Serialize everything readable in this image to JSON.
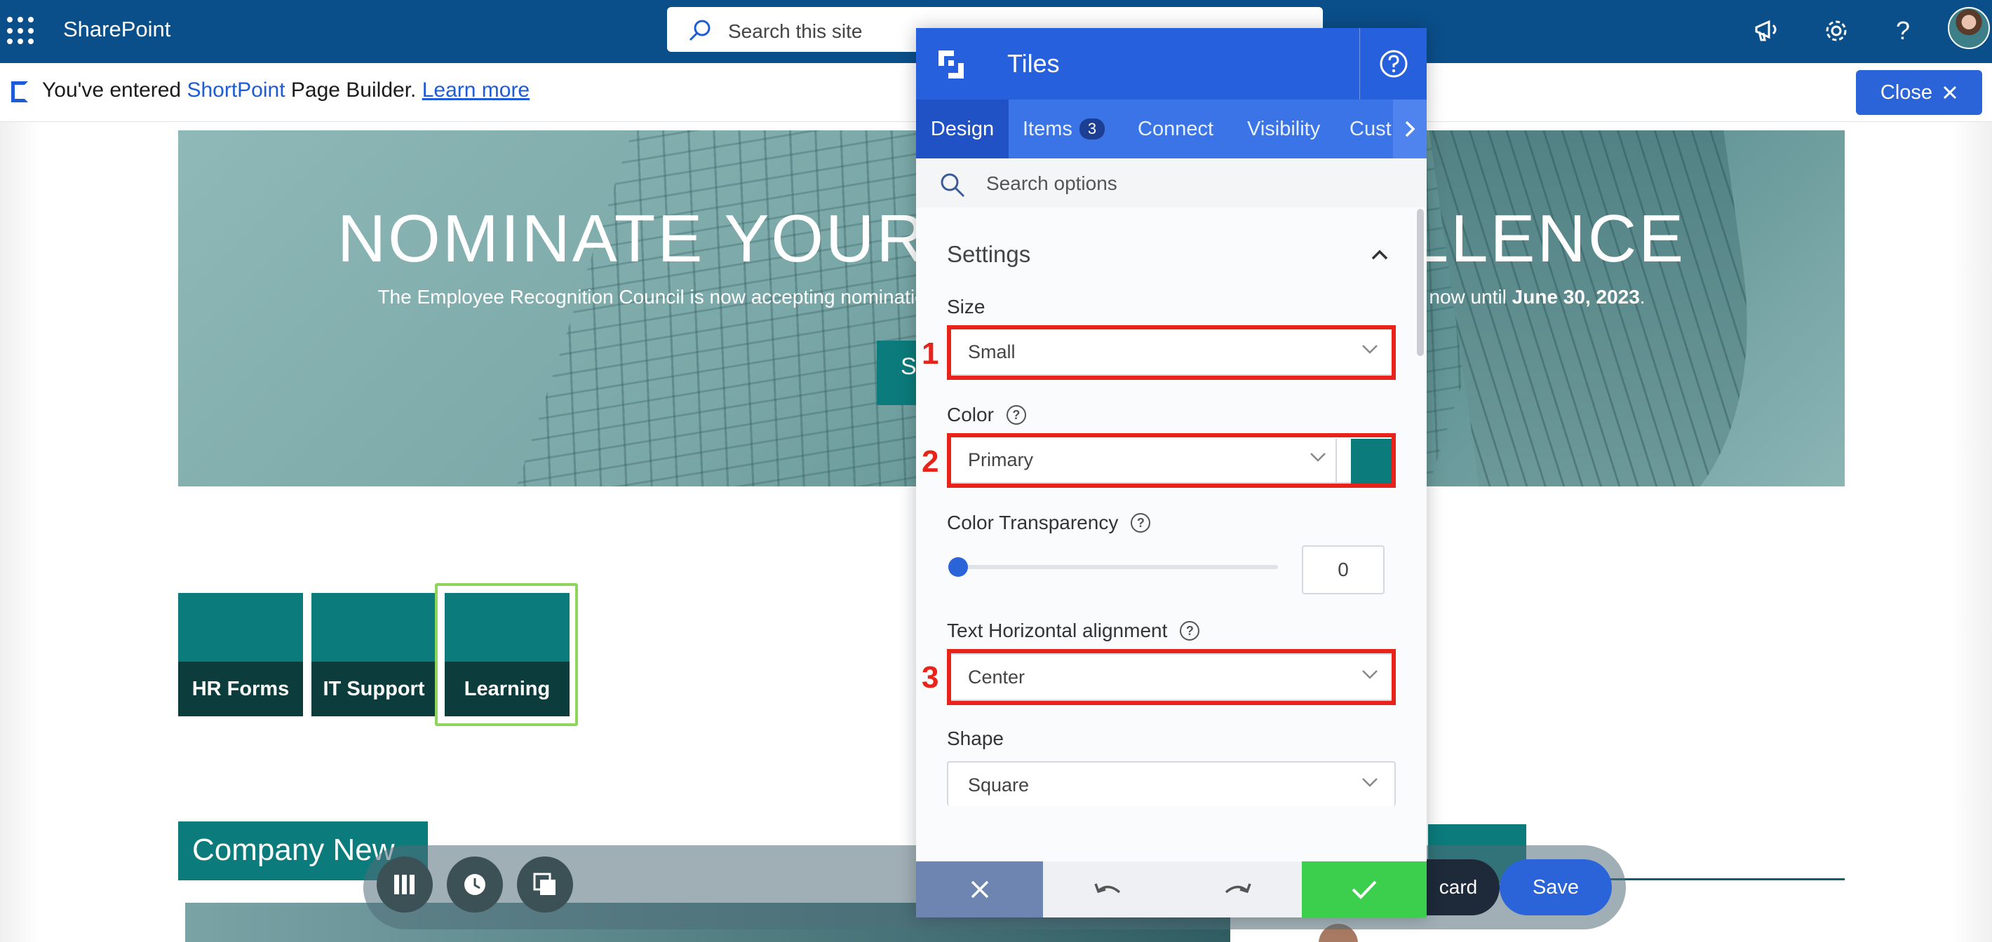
{
  "topbar": {
    "app_name": "SharePoint",
    "search_placeholder": "Search this site",
    "help_glyph": "?",
    "icons": [
      "waffle-icon",
      "search-icon",
      "megaphone-icon",
      "gear-icon",
      "help-icon",
      "avatar"
    ]
  },
  "notification": {
    "prefix": "You've entered ",
    "brand": "ShortPoint",
    "suffix": " Page Builder. ",
    "link": "Learn more",
    "close_label": "Close"
  },
  "hero": {
    "title_left": "NOMINATE YOUR",
    "title_right": "LLENCE",
    "subtitle_left": "The Employee Recognition Council is now accepting nominations fo",
    "subtitle_right": "tions now until ",
    "subtitle_date": "June 30, 2023",
    "subtitle_end": ".",
    "button_partial": "S"
  },
  "tiles": [
    "HR Forms",
    "IT Support",
    "Learning"
  ],
  "news": {
    "heading": "Company New"
  },
  "floating_toolbar": {
    "discard_partial": "card",
    "save_label": "Save"
  },
  "panel": {
    "title": "Tiles",
    "tabs": [
      {
        "label": "Design",
        "active": true
      },
      {
        "label": "Items",
        "badge": "3"
      },
      {
        "label": "Connect"
      },
      {
        "label": "Visibility"
      },
      {
        "label": "Cust"
      }
    ],
    "search_placeholder": "Search options",
    "section": "Settings",
    "size_label": "Size",
    "size_value": "Small",
    "color_label": "Color",
    "color_value": "Primary",
    "color_swatch": "#0c7b7b",
    "transparency_label": "Color Transparency",
    "transparency_value": "0",
    "align_label": "Text Horizontal alignment",
    "align_value": "Center",
    "shape_label": "Shape",
    "shape_value": "Square"
  },
  "annotations": [
    "1",
    "2",
    "3"
  ],
  "colors": {
    "brand_blue": "#0a4f8a",
    "panel_blue": "#2760dc",
    "teal": "#0c7b7b",
    "annotation_red": "#e8231a",
    "confirm_green": "#3ccf4e"
  }
}
